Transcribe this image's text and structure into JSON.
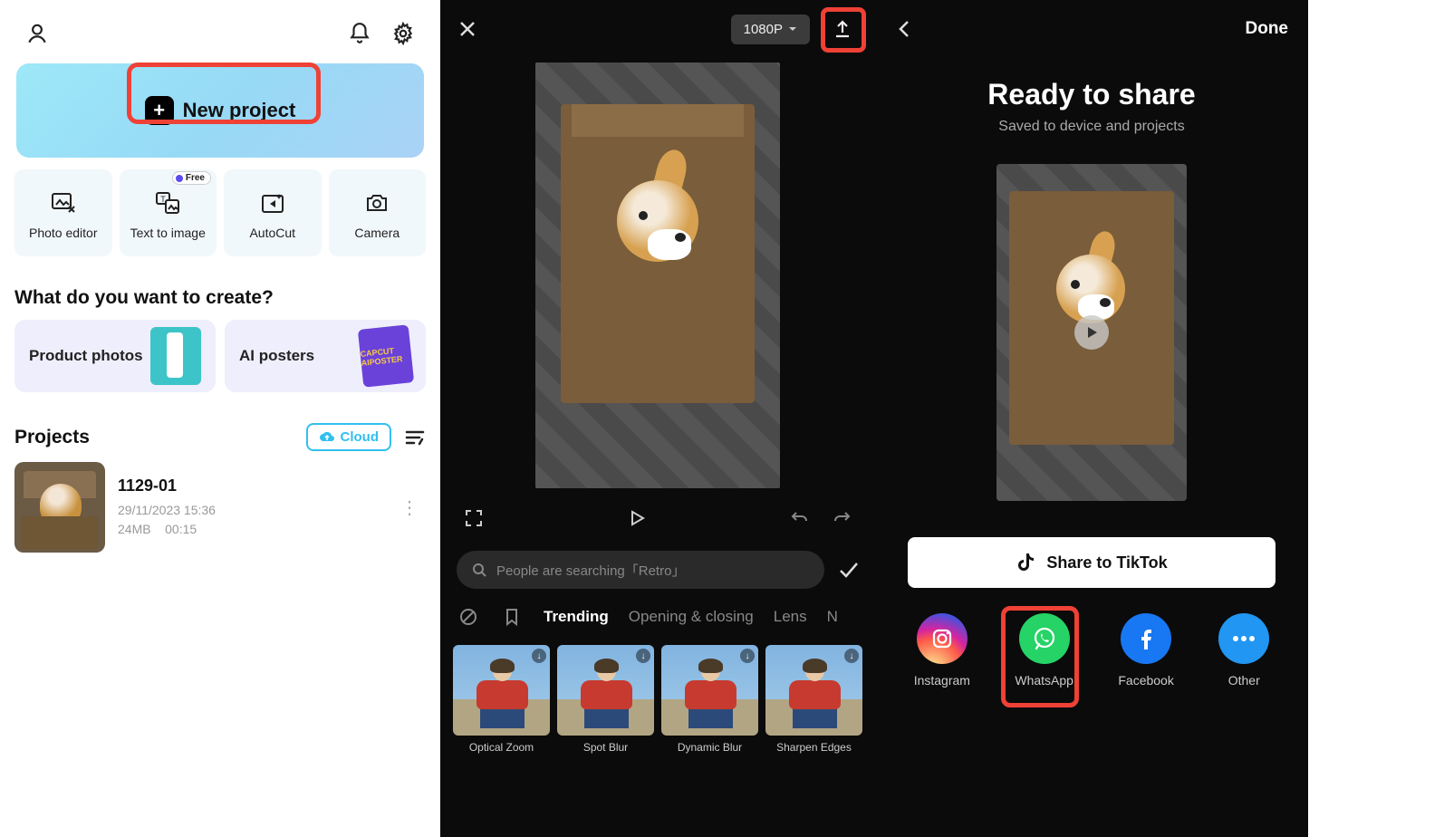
{
  "panel1": {
    "new_project": "New project",
    "tools": [
      {
        "label": "Photo editor"
      },
      {
        "label": "Text to image",
        "badge": "Free"
      },
      {
        "label": "AutoCut"
      },
      {
        "label": "Camera"
      }
    ],
    "create_title": "What do you want to create?",
    "creates": [
      {
        "label": "Product photos"
      },
      {
        "label": "AI posters",
        "thumb_text": "CAPCUT AIPOSTER"
      }
    ],
    "projects_title": "Projects",
    "cloud_label": "Cloud",
    "project": {
      "name": "1129-01",
      "date": "29/11/2023 15:36",
      "size": "24MB",
      "duration": "00:15"
    }
  },
  "panel2": {
    "resolution": "1080P",
    "search_placeholder": "People are searching「Retro」",
    "tabs": [
      "Trending",
      "Opening & closing",
      "Lens",
      "N"
    ],
    "effects": [
      "Optical Zoom",
      "Spot Blur",
      "Dynamic Blur",
      "Sharpen Edges"
    ]
  },
  "panel3": {
    "done": "Done",
    "title": "Ready to share",
    "subtitle": "Saved to device and projects",
    "tiktok_label": "Share to TikTok",
    "shares": [
      "Instagram",
      "WhatsApp",
      "Facebook",
      "Other"
    ]
  }
}
